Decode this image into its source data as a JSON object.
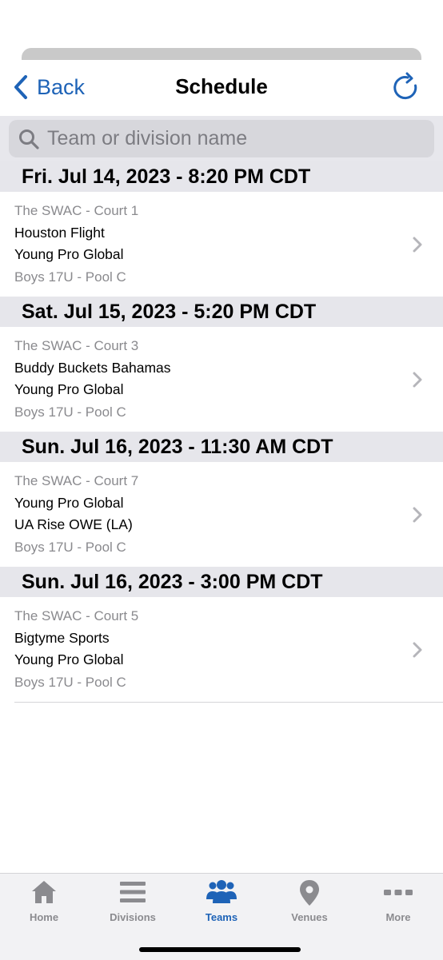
{
  "nav": {
    "back_label": "Back",
    "title": "Schedule"
  },
  "search": {
    "placeholder": "Team or division name"
  },
  "games": [
    {
      "date": "Fri. Jul 14, 2023 - 8:20 PM CDT",
      "venue": "The SWAC - Court 1",
      "team1": "Houston Flight",
      "team2": "Young Pro Global",
      "division": "Boys 17U - Pool C"
    },
    {
      "date": "Sat. Jul 15, 2023 - 5:20 PM CDT",
      "venue": "The SWAC - Court 3",
      "team1": "Buddy Buckets Bahamas",
      "team2": "Young Pro Global",
      "division": "Boys 17U - Pool C"
    },
    {
      "date": "Sun. Jul 16, 2023 - 11:30 AM CDT",
      "venue": "The SWAC - Court 7",
      "team1": "Young Pro Global",
      "team2": "UA Rise OWE (LA)",
      "division": "Boys 17U - Pool C"
    },
    {
      "date": "Sun. Jul 16, 2023 - 3:00 PM CDT",
      "venue": "The SWAC - Court 5",
      "team1": "Bigtyme Sports",
      "team2": "Young Pro Global",
      "division": "Boys 17U - Pool C"
    }
  ],
  "tabs": [
    {
      "label": "Home",
      "icon": "home-icon",
      "active": false
    },
    {
      "label": "Divisions",
      "icon": "list-icon",
      "active": false
    },
    {
      "label": "Teams",
      "icon": "people-icon",
      "active": true
    },
    {
      "label": "Venues",
      "icon": "location-pin-icon",
      "active": false
    },
    {
      "label": "More",
      "icon": "more-dots-icon",
      "active": false
    }
  ],
  "colors": {
    "accent": "#1e63b7",
    "inactive_tab": "#8b8b8f",
    "section_header_bg": "#e6e6eb",
    "secondary_text": "#8a8a8e"
  }
}
